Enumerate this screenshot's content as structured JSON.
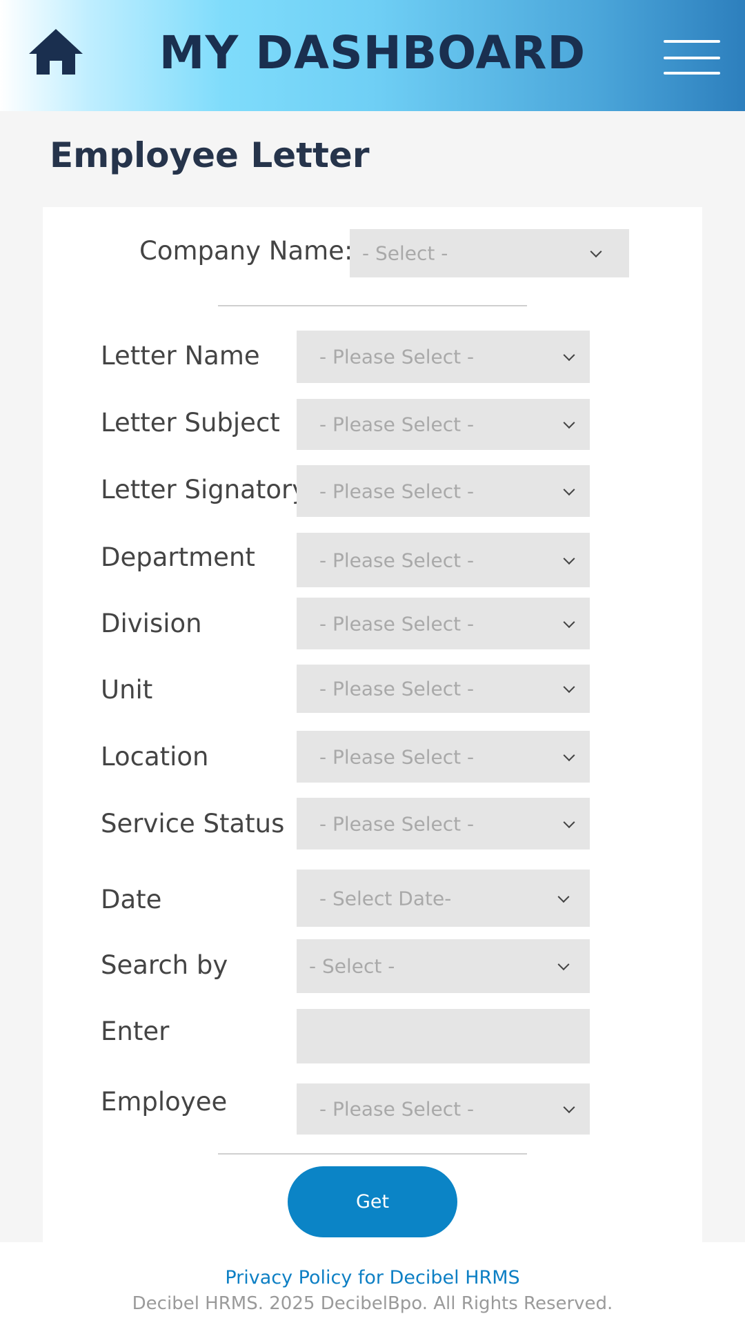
{
  "header": {
    "title": "MY DASHBOARD",
    "home_icon": "home-icon",
    "menu_icon": "hamburger-menu-icon",
    "title_color": "#1a2f4f"
  },
  "page": {
    "heading": "Employee Letter"
  },
  "form": {
    "company": {
      "label": "Company Name:",
      "value": "- Select -"
    },
    "fields": [
      {
        "label": "Letter Name",
        "value": "- Please Select -"
      },
      {
        "label": "Letter Subject",
        "value": "- Please Select -"
      },
      {
        "label": "Letter Signatory",
        "value": "- Please Select -"
      },
      {
        "label": "Department",
        "value": "- Please Select -"
      },
      {
        "label": "Division",
        "value": "- Please Select -"
      },
      {
        "label": "Unit",
        "value": "- Please Select -"
      },
      {
        "label": "Location",
        "value": "- Please Select -"
      },
      {
        "label": "Service Status",
        "value": "- Please Select -"
      },
      {
        "label": "Date",
        "value": "- Select Date-"
      },
      {
        "label": "Search by",
        "value": "- Select -"
      },
      {
        "label": "Enter",
        "value": ""
      },
      {
        "label": "Employee",
        "value": "- Please Select -"
      }
    ],
    "submit_label": "Get",
    "accent_color": "#0b84c6"
  },
  "footer": {
    "privacy_link": "Privacy Policy for Decibel HRMS",
    "copyright": "Decibel HRMS. 2025 DecibelBpo. All Rights Reserved."
  }
}
